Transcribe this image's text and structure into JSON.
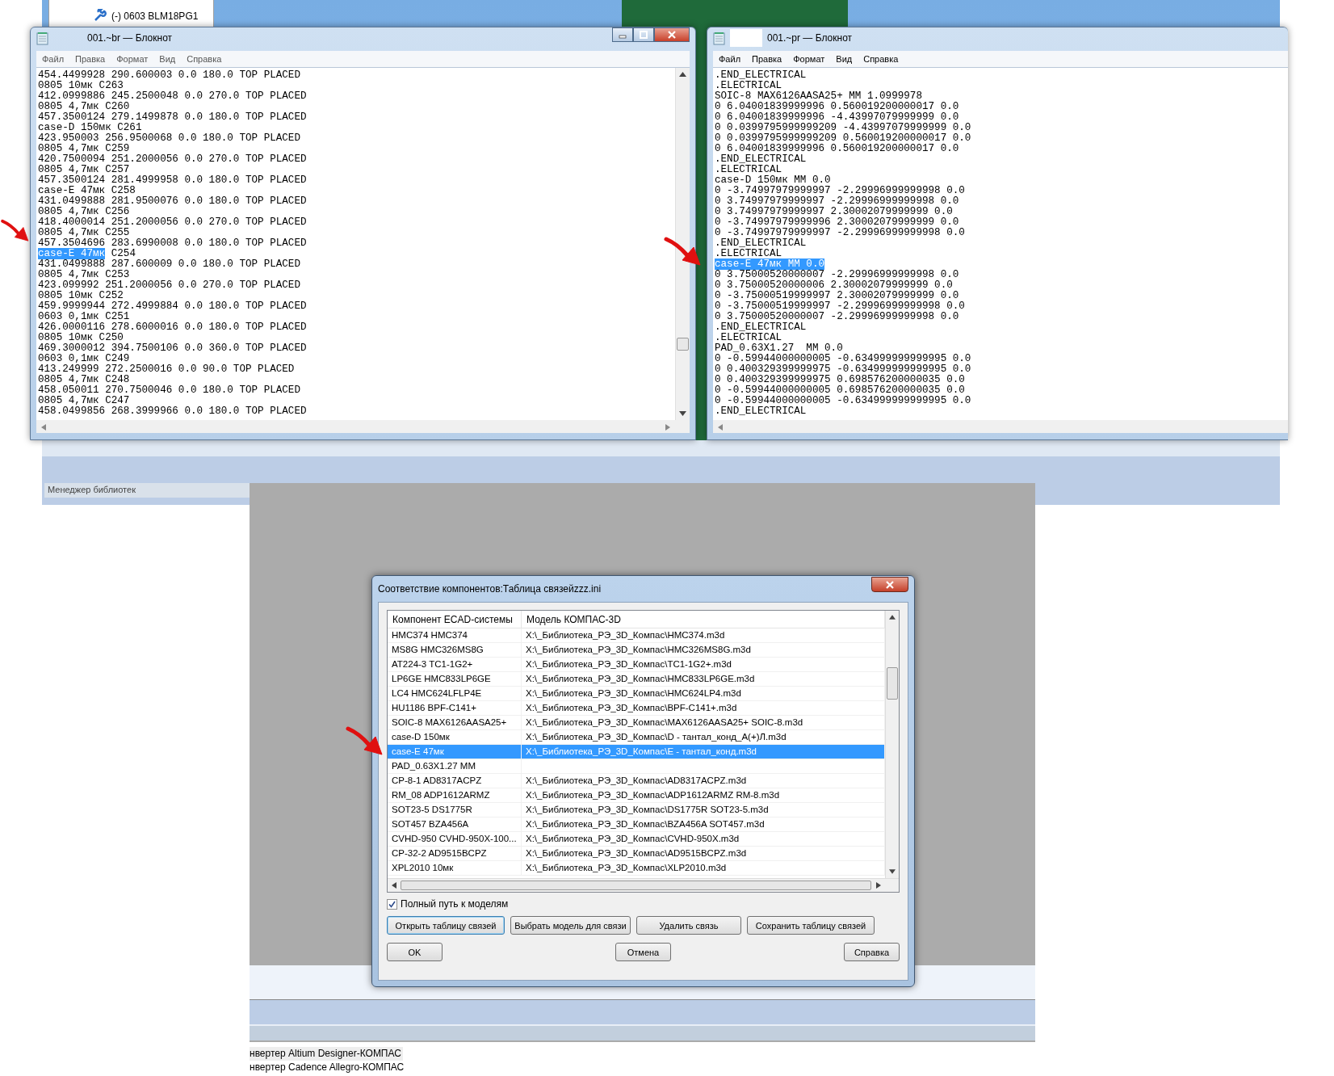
{
  "background": {
    "tree_item": "(-) 0603 BLM18PG1",
    "library_panel_title": "Менеджер библиотек"
  },
  "notepads": [
    {
      "title": "001.~br — Блокнот",
      "title_redacted": false,
      "window_buttons": true,
      "vertical_scrollbar": true,
      "menu": [
        "Файл",
        "Правка",
        "Формат",
        "Вид",
        "Справка"
      ],
      "lines": [
        {
          "text": "454.4499928 290.600003 0.0 180.0 TOP PLACED"
        },
        {
          "text": "0805 10мк C263"
        },
        {
          "text": "412.0999886 245.2500048 0.0 270.0 TOP PLACED"
        },
        {
          "text": "0805 4,7мк C260"
        },
        {
          "text": "457.3500124 279.1499878 0.0 180.0 TOP PLACED"
        },
        {
          "text": "case-D 150мк C261"
        },
        {
          "text": "423.950003 256.9500068 0.0 180.0 TOP PLACED"
        },
        {
          "text": "0805 4,7мк C259"
        },
        {
          "text": "420.7500094 251.2000056 0.0 270.0 TOP PLACED"
        },
        {
          "text": "0805 4,7мк C257"
        },
        {
          "text": "457.3500124 281.4999958 0.0 180.0 TOP PLACED"
        },
        {
          "text": "case-E 47мк C258"
        },
        {
          "text": "431.0499888 281.9500076 0.0 180.0 TOP PLACED"
        },
        {
          "text": "0805 4,7мк C256"
        },
        {
          "text": "418.4000014 251.2000056 0.0 270.0 TOP PLACED"
        },
        {
          "text": "0805 4,7мк C255"
        },
        {
          "text": "457.3504696 283.6990008 0.0 180.0 TOP PLACED"
        },
        {
          "selection": "case-E 47мк",
          "text": "C254"
        },
        {
          "text": "431.0499888 287.600009 0.0 180.0 TOP PLACED"
        },
        {
          "text": "0805 4,7мк C253"
        },
        {
          "text": "423.099992 251.2000056 0.0 270.0 TOP PLACED"
        },
        {
          "text": "0805 10мк C252"
        },
        {
          "text": "459.9999944 272.4999884 0.0 180.0 TOP PLACED"
        },
        {
          "text": "0603 0,1мк C251"
        },
        {
          "text": "426.0000116 278.6000016 0.0 180.0 TOP PLACED"
        },
        {
          "text": "0805 10мк C250"
        },
        {
          "text": "469.3000012 394.7500106 0.0 360.0 TOP PLACED"
        },
        {
          "text": "0603 0,1мк C249"
        },
        {
          "text": "413.249999 272.2500016 0.0 90.0 TOP PLACED"
        },
        {
          "text": "0805 4,7мк C248"
        },
        {
          "text": "458.050011 270.7500046 0.0 180.0 TOP PLACED"
        },
        {
          "text": "0805 4,7мк C247"
        },
        {
          "text": "458.0499856 268.3999966 0.0 180.0 TOP PLACED"
        }
      ]
    },
    {
      "title": "001.~pr — Блокнот",
      "title_redacted": true,
      "window_buttons": false,
      "vertical_scrollbar": false,
      "menu": [
        "Файл",
        "Правка",
        "Формат",
        "Вид",
        "Справка"
      ],
      "lines": [
        {
          "text": ".END_ELECTRICAL"
        },
        {
          "text": ".ELECTRICAL"
        },
        {
          "text": "SOIC-8 MAX6126AASA25+ MM 1.0999978"
        },
        {
          "text": "0 6.04001839999996 0.560019200000017 0.0"
        },
        {
          "text": "0 6.04001839999996 -4.43997079999999 0.0"
        },
        {
          "text": "0 0.0399795999999209 -4.43997079999999 0.0"
        },
        {
          "text": "0 0.0399795999999209 0.560019200000017 0.0"
        },
        {
          "text": "0 6.04001839999996 0.560019200000017 0.0"
        },
        {
          "text": ".END_ELECTRICAL"
        },
        {
          "text": ".ELECTRICAL"
        },
        {
          "text": "case-D 150мк MM 0.0"
        },
        {
          "text": "0 -3.74997979999997 -2.29996999999998 0.0"
        },
        {
          "text": "0 3.74997979999997 -2.29996999999998 0.0"
        },
        {
          "text": "0 3.74997979999997 2.30002079999999 0.0"
        },
        {
          "text": "0 -3.74997979999996 2.30002079999999 0.0"
        },
        {
          "text": "0 -3.74997979999997 -2.29996999999998 0.0"
        },
        {
          "text": ".END_ELECTRICAL"
        },
        {
          "text": ".ELECTRICAL"
        },
        {
          "selection": "case-E 47мк MM 0.0"
        },
        {
          "text": "0 3.75000520000007 -2.29996999999998 0.0"
        },
        {
          "text": "0 3.75000520000006 2.30002079999999 0.0"
        },
        {
          "text": "0 -3.75000519999997 2.30002079999999 0.0"
        },
        {
          "text": "0 -3.75000519999997 -2.29996999999998 0.0"
        },
        {
          "text": "0 3.75000520000007 -2.29996999999998 0.0"
        },
        {
          "text": ".END_ELECTRICAL"
        },
        {
          "text": ".ELECTRICAL"
        },
        {
          "text": "PAD_0.63X1.27  MM 0.0"
        },
        {
          "text": "0 -0.59944000000005 -0.634999999999995 0.0"
        },
        {
          "text": "0 0.400329399999975 -0.634999999999995 0.0"
        },
        {
          "text": "0 0.400329399999975 0.698576200000035 0.0"
        },
        {
          "text": "0 -0.59944000000005 0.698576200000035 0.0"
        },
        {
          "text": "0 -0.59944000000005 -0.634999999999995 0.0"
        },
        {
          "text": ".END_ELECTRICAL"
        }
      ]
    }
  ],
  "dialog": {
    "title": "Соответствие компонентов:Таблица связейzzz.ini",
    "columns": [
      "Компонент ECAD-системы",
      "Модель КОМПАС-3D"
    ],
    "rows": [
      {
        "component": "HMC374 HMC374",
        "model": "X:\\_Библиотека_РЭ_3D_Компас\\HMC374.m3d",
        "selected": false
      },
      {
        "component": "MS8G HMC326MS8G",
        "model": "X:\\_Библиотека_РЭ_3D_Компас\\HMC326MS8G.m3d",
        "selected": false
      },
      {
        "component": "AT224-3 TC1-1G2+",
        "model": "X:\\_Библиотека_РЭ_3D_Компас\\TC1-1G2+.m3d",
        "selected": false
      },
      {
        "component": "LP6GE HMC833LP6GE",
        "model": "X:\\_Библиотека_РЭ_3D_Компас\\HMC833LP6GE.m3d",
        "selected": false
      },
      {
        "component": "LC4 HMC624LFLP4E",
        "model": "X:\\_Библиотека_РЭ_3D_Компас\\HMC624LP4.m3d",
        "selected": false
      },
      {
        "component": "HU1186 BPF-C141+",
        "model": "X:\\_Библиотека_РЭ_3D_Компас\\BPF-C141+.m3d",
        "selected": false
      },
      {
        "component": "SOIC-8 MAX6126AASA25+",
        "model": "X:\\_Библиотека_РЭ_3D_Компас\\MAX6126AASA25+ SOIC-8.m3d",
        "selected": false
      },
      {
        "component": "case-D 150мк",
        "model": "X:\\_Библиотека_РЭ_3D_Компас\\D - тантал_конд_A(+)Л.m3d",
        "selected": false
      },
      {
        "component": "case-E 47мк",
        "model": "X:\\_Библиотека_РЭ_3D_Компас\\E - тантал_конд.m3d",
        "selected": true
      },
      {
        "component": "PAD_0.63X1.27 MM",
        "selected": false
      },
      {
        "component": "CP-8-1 AD8317ACPZ",
        "model": "X:\\_Библиотека_РЭ_3D_Компас\\AD8317ACPZ.m3d",
        "selected": false
      },
      {
        "component": "RM_08 ADP1612ARMZ",
        "model": "X:\\_Библиотека_РЭ_3D_Компас\\ADP1612ARMZ RM-8.m3d",
        "selected": false
      },
      {
        "component": "SOT23-5 DS1775R",
        "model": "X:\\_Библиотека_РЭ_3D_Компас\\DS1775R SOT23-5.m3d",
        "selected": false
      },
      {
        "component": "SOT457 BZA456A",
        "model": "X:\\_Библиотека_РЭ_3D_Компас\\BZA456A SOT457.m3d",
        "selected": false
      },
      {
        "component": "CVHD-950 CVHD-950X-100...",
        "model": "X:\\_Библиотека_РЭ_3D_Компас\\CVHD-950X.m3d",
        "selected": false
      },
      {
        "component": "CP-32-2 AD9515BCPZ",
        "model": "X:\\_Библиотека_РЭ_3D_Компас\\AD9515BCPZ.m3d",
        "selected": false
      },
      {
        "component": "XPL2010 10мк",
        "model": "X:\\_Библиотека_РЭ_3D_Компас\\XLP2010.m3d",
        "selected": false
      }
    ],
    "checkbox": {
      "label": "Полный путь к моделям",
      "checked": true
    },
    "action_buttons": [
      {
        "label": "Открыть таблицу связей",
        "focused": true
      },
      {
        "label": "Выбрать модель для связи",
        "focused": false
      },
      {
        "label": "Удалить связь",
        "focused": false
      },
      {
        "label": "Сохранить таблицу связей",
        "focused": false
      }
    ],
    "buttons": [
      "OK",
      "Отмена",
      "Справка"
    ]
  },
  "converter_list": [
    {
      "label": "нвертер Altium Designer-КОМПАС",
      "selected": true
    },
    {
      "label": "нвертер Cadence Allegro-КОМПАС",
      "selected": false
    }
  ]
}
